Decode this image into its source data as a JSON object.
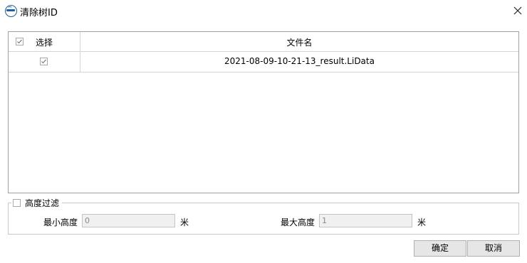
{
  "window": {
    "title": "清除树ID",
    "close_icon": "close-icon",
    "logo_icon": "app-logo-icon"
  },
  "grid": {
    "header": {
      "select_label": "选择",
      "filename_label": "文件名",
      "select_all_checked": true
    },
    "rows": [
      {
        "checked": true,
        "filename": "2021-08-09-10-21-13_result.LiData"
      }
    ]
  },
  "height_filter": {
    "label": "高度过滤",
    "enabled": false,
    "min_label": "最小高度",
    "min_value": "0",
    "min_unit": "米",
    "max_label": "最大高度",
    "max_value": "1",
    "max_unit": "米"
  },
  "buttons": {
    "ok": "确定",
    "cancel": "取消"
  }
}
